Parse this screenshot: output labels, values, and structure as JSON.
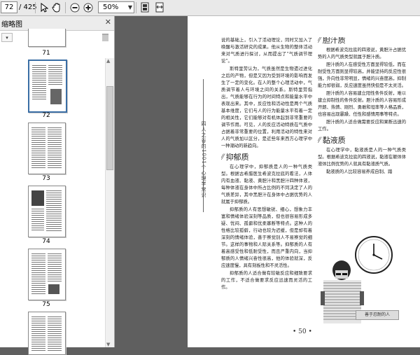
{
  "toolbar": {
    "page_current": "72",
    "page_total": "/ 425",
    "zoom": "50%"
  },
  "thumbnails": {
    "title": "缩略图",
    "items": [
      {
        "label": "71"
      },
      {
        "label": "72"
      },
      {
        "label": "73"
      },
      {
        "label": "74"
      },
      {
        "label": "75"
      }
    ]
  },
  "document": {
    "side_title": "四人之谷的1001个心理学常识",
    "page_number": "• 50 •",
    "col1_p1": "说的基础上，引入了活动理论，同时又加入了唤醒与激活研究的成果。他从生物的整体活动来对气质进行探讨，从而提出了“气质调节理论”。",
    "col1_p2": "斯特里劳认为，气质虽然是生物遗过进化之后的产物，但是又因为受到环境的影响而发生了一定的变化。在人的整个心理活动中，气质调节着人与环境之间的关系。斯特里劳指出，气质能够在行为的时间特点和能量水平中表现出来。其中，反应性和活动性是两个气质基本维度，它们与人的行为能量水平有着一定的相关性，它们能够对有机体起到非常重要的调节作用。可见，人的反应活动特质在气质中占据着非常重要的位置，利用活动的特性来对人的气质加以区分，是近些年来西方心理学中一种潮动的新趋向。",
    "col1_h1": "抑郁质",
    "col1_p3": "在心理学中，抑郁质是人的一种气质类型。根据古希腊医生希波克拉底的看法，人体内有血液、黏液、黄胆汁和黑胆汁四种体液，每种体液在身体中所占比例的不同决定了人的气质差异，其中黑胆汁在身体中占据优势的人就属于抑郁质。",
    "col1_p4": "抑郁质的人有思想敏锐、细心，想象力丰富和情绪体验深刻等品质，但也很容易形成多疑、忧闷、孤僻和优柔寡断等特点。这种人的性格比较孤僻，行动也较为迟缓，但是却有着深刻的情绪体验，善于察觉别人不易察觉的细节。这样的事物和人际关系等。抑郁质的人有着高感受性和低耐受性，而且严重内向，当抑郁质的人情绪兴奋性很高，他的体验就深，反应速度慢，具有刻板性和不灵活性。",
    "col1_p5": "抑郁质的人适合做有较敏反应和细致要求的工作，不适合做要求反应迅速而灵活的工作。",
    "col2_h1": "胆汁质",
    "col2_p1": "根据希波克拉底的四液说，黄胆汁占据优势的人的气质类型就属于胆汁质。",
    "col2_p2": "胆汁质的人在感受性方面显得较低，而在耐受性方面则显得较高，并能坚持的反应性很强，外向性非常明显，情绪的兴奋度高，抑制能力却很弱，反应速度虽然快但是不太灵活。",
    "col2_p3": "胆汁质的人容易建立阳性条件反射，难以建立抑制性的条件反射。胆汁质的人容易形成开朗、热情、刚烈、勇敢和坦率等人格品质，也容易出现暴躁、任性和感情用事等特点。",
    "col2_p4": "胆汁质的人适合做需要反应和果断迅速的工作。",
    "col2_h2": "黏液质",
    "col2_p5": "在心理学中，黏液质是人的一种气质类型。根据希波克拉底的四液说，黏液在躯体体液体比例优势的人就具有黏液质气质。",
    "col2_p6": "黏液质的人比较容易养成自制、踏",
    "photo_caption": "善于忍耐的人"
  },
  "colors": {
    "app_bg": "#5f5f5f",
    "toolbar_bg": "#e9e9e9",
    "panel_bg": "#ffffff"
  }
}
